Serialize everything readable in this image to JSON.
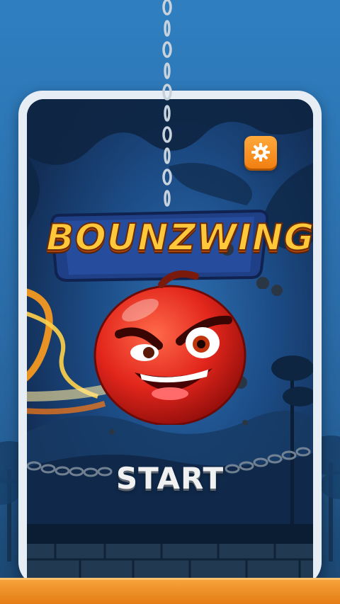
{
  "game": {
    "title": "BOUNZWING",
    "start_label": "START"
  },
  "icons": {
    "settings": "gear-icon",
    "chain": "chain-icon",
    "ball": "angry-red-ball-character"
  },
  "colors": {
    "sky": "#2f7fc0",
    "settings_button": "#f5901f",
    "logo_fill": "#ffc83a",
    "ball": "#e8291f",
    "bottom_bar": "#ee8c22"
  }
}
